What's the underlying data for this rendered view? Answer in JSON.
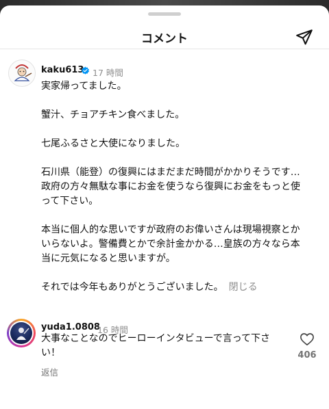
{
  "sheet": {
    "title": "コメント"
  },
  "icons": {
    "share": "paper-plane-icon",
    "like": "heart-outline-icon",
    "verified": "verified-badge-icon"
  },
  "colors": {
    "verified": "#0095f6",
    "muted": "#8e8e8e"
  },
  "comments": [
    {
      "username": "kaku613",
      "verified": true,
      "time": "17 時間",
      "paragraphs": [
        [
          "実家帰ってました。"
        ],
        [
          "蟹汁、チョアチキン食べました。"
        ],
        [
          "七尾ふるさと大使になりました。"
        ],
        [
          "石川県（能登）の復興にはまだまだ時間がかかりそうです…",
          "政府の方々無駄な事にお金を使うなら復興にお金をもっと使",
          "って下さい。"
        ],
        [
          "本当に個人的な思いですが政府のお偉いさんは現場視察とか",
          "いらないよ。警備費とかで余計金かかる…皇族の方々なら本",
          "当に元気になると思いますが。"
        ],
        [
          "それでは今年もありがとうございました。"
        ]
      ],
      "collapse_label": "閉じる"
    },
    {
      "username": "yuda1.0808",
      "time": "16 時間",
      "lines": [
        "大事なことなのでヒーローインタビューで言って下さ",
        "い！"
      ],
      "reply_label": "返信",
      "like_count": "406"
    }
  ]
}
